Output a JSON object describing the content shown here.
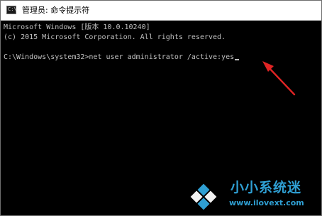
{
  "window": {
    "title": "管理员: 命令提示符",
    "icon": "cmd-prompt-icon"
  },
  "console": {
    "lines": [
      "Microsoft Windows [版本 10.0.10240]",
      "(c) 2015 Microsoft Corporation. All rights reserved.",
      "C:\\Windows\\system32>net user administrator /active:yes"
    ]
  },
  "annotation": {
    "color": "#e02424"
  },
  "watermark": {
    "title": "小小系统迷",
    "url": "www.ilovext.com",
    "color": "#2f9fd3"
  }
}
